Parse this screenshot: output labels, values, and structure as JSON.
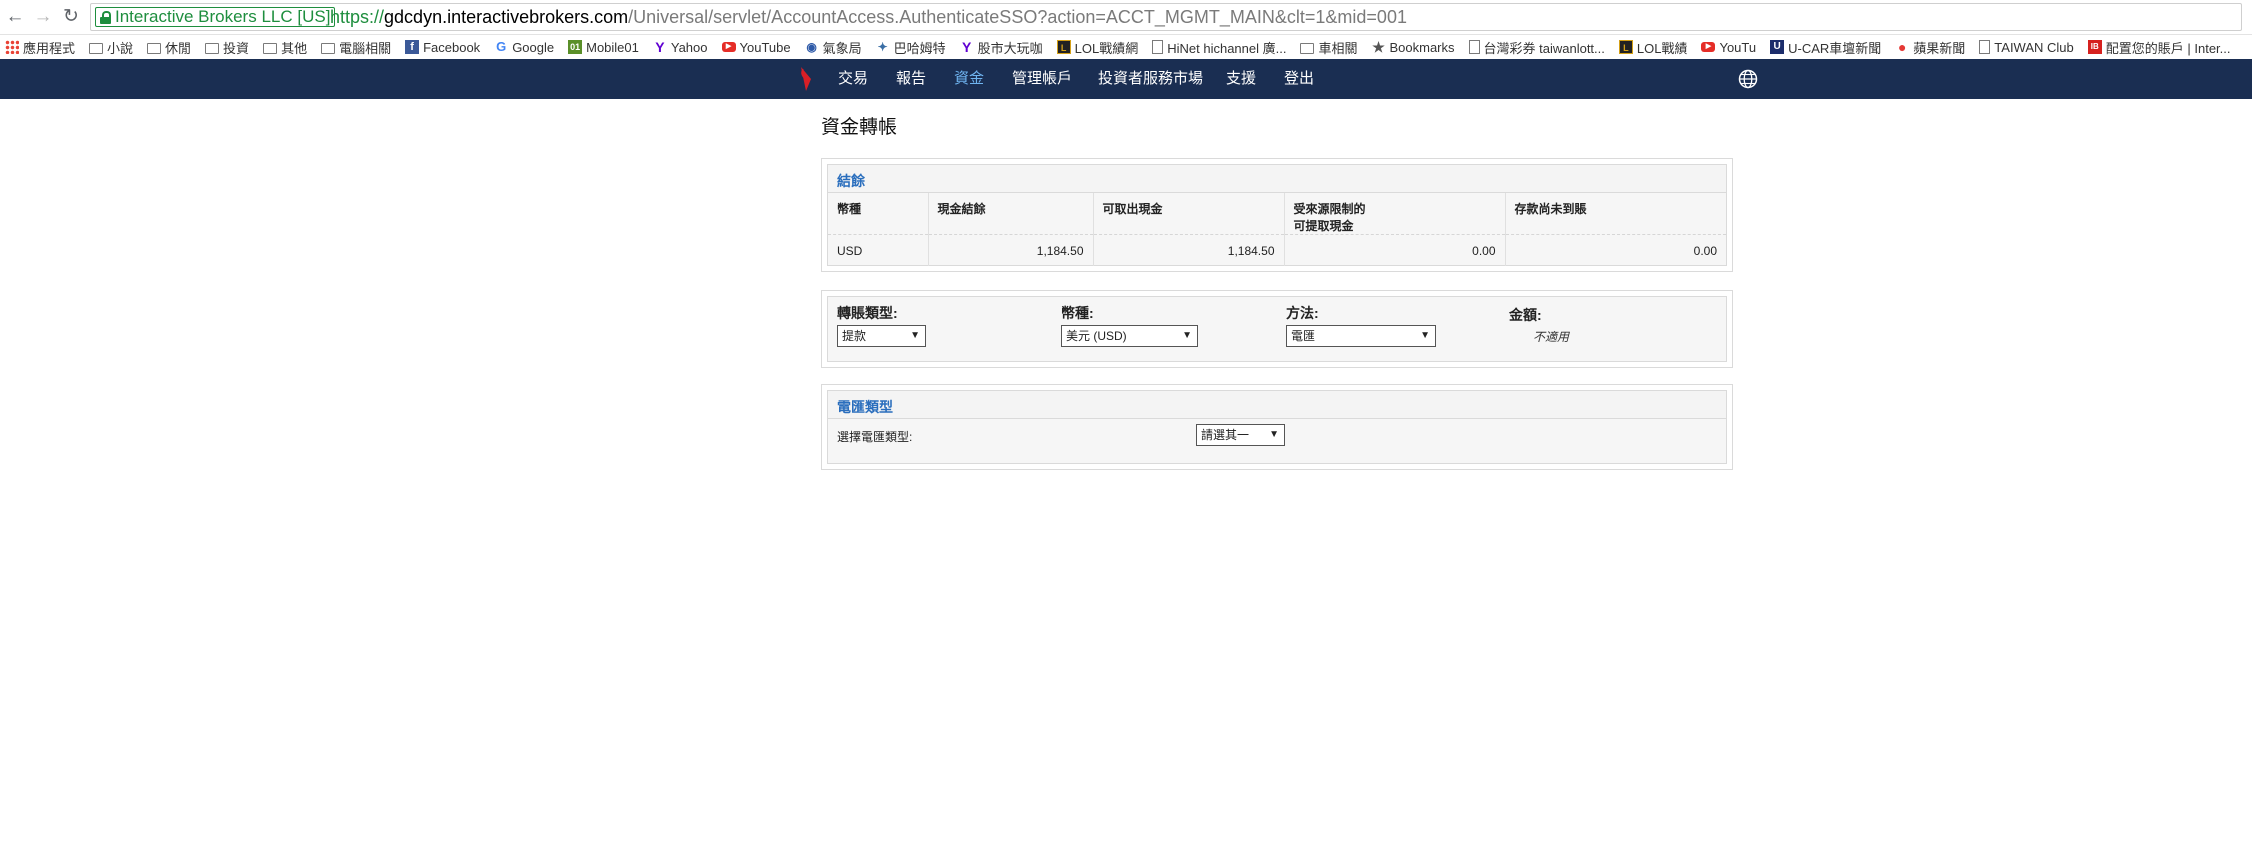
{
  "browser": {
    "secure_label": "Interactive Brokers LLC [US]",
    "url_scheme": "https://",
    "url_host": "gdcdyn.interactivebrokers.com",
    "url_path": "/Universal/servlet/AccountAccess.AuthenticateSSO?action=ACCT_MGMT_MAIN&clt=1&mid=001",
    "bookmarks": [
      {
        "label": "應用程式",
        "icon": "apps-icon"
      },
      {
        "label": "小說",
        "icon": "folder-icon"
      },
      {
        "label": "休閒",
        "icon": "folder-icon"
      },
      {
        "label": "投資",
        "icon": "folder-icon"
      },
      {
        "label": "其他",
        "icon": "folder-icon"
      },
      {
        "label": "電腦相關",
        "icon": "folder-icon"
      },
      {
        "label": "Facebook",
        "icon": "facebook-icon"
      },
      {
        "label": "Google",
        "icon": "google-icon"
      },
      {
        "label": "Mobile01",
        "icon": "mobile01-icon"
      },
      {
        "label": "Yahoo",
        "icon": "yahoo-icon"
      },
      {
        "label": "YouTube",
        "icon": "youtube-icon"
      },
      {
        "label": "氣象局",
        "icon": "eye-icon"
      },
      {
        "label": "巴哈姆特",
        "icon": "bird-icon"
      },
      {
        "label": "股市大玩咖",
        "icon": "yahoo-icon"
      },
      {
        "label": "LOL戰績網",
        "icon": "lol-icon"
      },
      {
        "label": "HiNet hichannel 廣...",
        "icon": "page-icon"
      },
      {
        "label": "車相關",
        "icon": "folder-icon"
      },
      {
        "label": "Bookmarks",
        "icon": "star-icon"
      },
      {
        "label": "台灣彩券 taiwanlott...",
        "icon": "page-icon"
      },
      {
        "label": "LOL戰績",
        "icon": "lol-icon"
      },
      {
        "label": "YouTu",
        "icon": "youtube-icon"
      },
      {
        "label": "U-CAR車壇新聞",
        "icon": "ucar-icon"
      },
      {
        "label": "蘋果新聞",
        "icon": "apple-icon"
      },
      {
        "label": "TAIWAN Club",
        "icon": "page-icon"
      },
      {
        "label": "配置您的賬戶 | Inter...",
        "icon": "ib-icon"
      }
    ]
  },
  "nav": {
    "items": [
      "交易",
      "報告",
      "資金",
      "管理帳戶",
      "投資者服務市場",
      "支援",
      "登出"
    ],
    "active_index": 2,
    "active_color": "#6fb4f0",
    "bar_color": "#1a2e52"
  },
  "page": {
    "title": "資金轉帳"
  },
  "balances": {
    "title": "結餘",
    "headers": [
      "幣種",
      "現金結餘",
      "可取出現金",
      "受來源限制的",
      "可提取現金",
      "存款尚未到賬"
    ],
    "row": {
      "currency": "USD",
      "cash_balance": "1,184.50",
      "withdrawable": "1,184.50",
      "restricted": "0.00",
      "pending": "0.00"
    }
  },
  "transfer": {
    "type_label": "轉賬類型:",
    "type_value": "提款",
    "currency_label": "幣種:",
    "currency_value": "美元 (USD)",
    "method_label": "方法:",
    "method_value": "電匯",
    "amount_label": "金額:",
    "amount_value": "不適用"
  },
  "wire": {
    "title": "電匯類型",
    "select_label": "選擇電匯類型:",
    "select_value": "請選其一"
  }
}
